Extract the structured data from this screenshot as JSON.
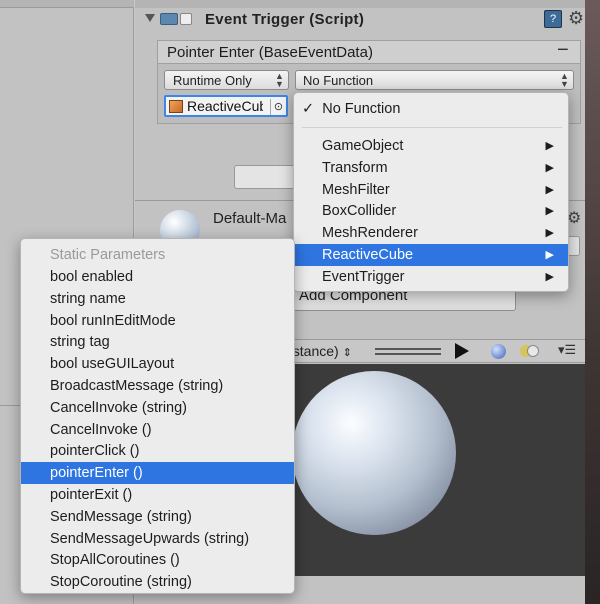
{
  "component": {
    "title": "Event Trigger (Script)"
  },
  "event_entry": {
    "header": "Pointer Enter (BaseEventData)",
    "remove_label": "−",
    "runtime": "Runtime Only",
    "function": "No Function",
    "target_object": "ReactiveCube"
  },
  "material": {
    "name": "Default-Ma"
  },
  "add_component": {
    "label": "Add Component"
  },
  "preview": {
    "label": "nstance)"
  },
  "function_menu": {
    "checked_item": "No Function",
    "items": [
      {
        "label": "GameObject",
        "has_submenu": true
      },
      {
        "label": "Transform",
        "has_submenu": true
      },
      {
        "label": "MeshFilter",
        "has_submenu": true
      },
      {
        "label": "BoxCollider",
        "has_submenu": true
      },
      {
        "label": "MeshRenderer",
        "has_submenu": true
      },
      {
        "label": "ReactiveCube",
        "has_submenu": true,
        "selected": true
      },
      {
        "label": "EventTrigger",
        "has_submenu": true
      }
    ]
  },
  "method_menu": {
    "section_header": "Static Parameters",
    "items": [
      {
        "label": "bool enabled"
      },
      {
        "label": "string name"
      },
      {
        "label": "bool runInEditMode"
      },
      {
        "label": "string tag"
      },
      {
        "label": "bool useGUILayout"
      },
      {
        "label": "BroadcastMessage (string)"
      },
      {
        "label": "CancelInvoke (string)"
      },
      {
        "label": "CancelInvoke ()"
      },
      {
        "label": "pointerClick ()"
      },
      {
        "label": "pointerEnter ()",
        "selected": true
      },
      {
        "label": "pointerExit ()"
      },
      {
        "label": "SendMessage (string)"
      },
      {
        "label": "SendMessageUpwards (string)"
      },
      {
        "label": "StopAllCoroutines ()"
      },
      {
        "label": "StopCoroutine (string)"
      }
    ]
  },
  "colors": {
    "selection": "#2e75e1",
    "focus_ring": "#3b86e6",
    "inspector_bg": "#c2c2c2",
    "preview_bg": "#3b3b3b"
  }
}
